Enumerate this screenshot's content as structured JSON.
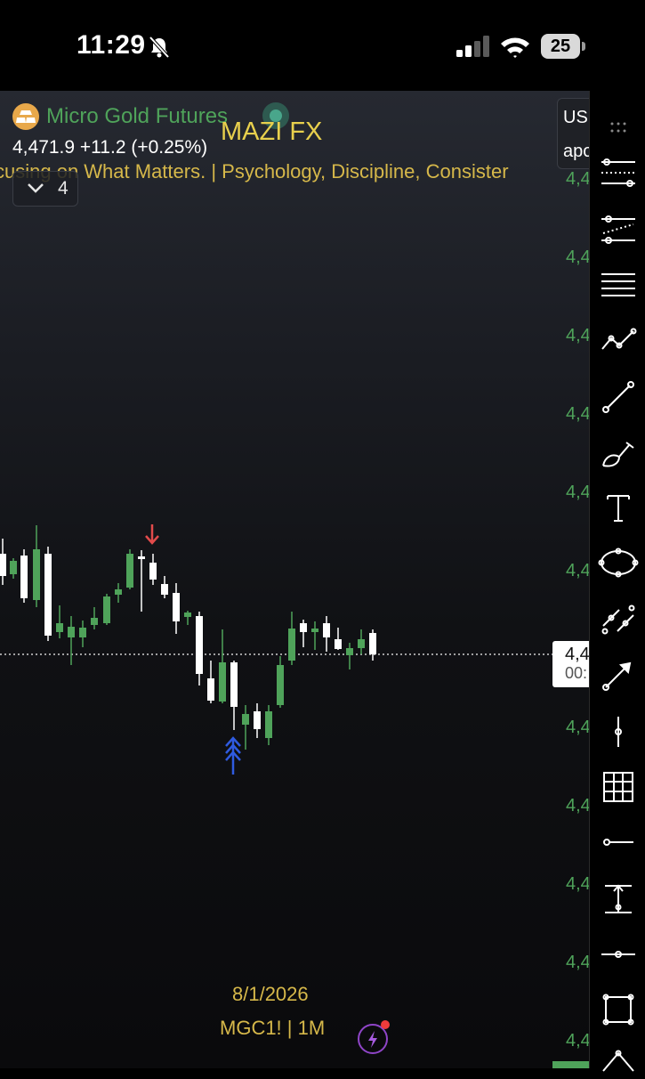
{
  "status_bar": {
    "time": "11:29",
    "battery": "25",
    "icons": [
      "bell-off-icon",
      "cellular-signal-icon",
      "wifi-icon",
      "battery-icon"
    ]
  },
  "chart_header": {
    "symbol_name": "Micro Gold Futures",
    "watermark_title": "MAZI FX",
    "last_price": "4,471.9",
    "change": "+11.2 (+0.25%)",
    "tagline": "cusing on What Matters. | Psychology, Discipline, Consister",
    "indicator_count": "4"
  },
  "currency_box": {
    "line1": "USD",
    "line2": "apo"
  },
  "price_axis": {
    "labels": [
      "4,4",
      "4,4",
      "4,4",
      "4,4",
      "4,4",
      "4,4",
      "4,4",
      "4,4",
      "4,4",
      "4,4",
      "4,4",
      "4,4"
    ],
    "current_price_tag": "4,4",
    "countdown": "00:"
  },
  "footer": {
    "date": "8/1/2026",
    "ticker": "MGC1! | 1M"
  },
  "colors": {
    "up_candle": "#4fa35a",
    "down_candle": "#ffffff",
    "price_text": "#4fa35a",
    "watermark": "#e8d04d",
    "sell_arrow": "#e24b4b",
    "buy_arrow": "#2f5be0"
  },
  "toolbar": {
    "tools": [
      "drag-handle-icon",
      "horizontal-ray-icon",
      "parallel-channel-icon",
      "horizontal-lines-icon",
      "zigzag-pattern-icon",
      "trend-line-icon",
      "brush-icon",
      "text-icon",
      "ellipse-icon",
      "parallel-lines-icon",
      "arrow-icon",
      "vertical-line-icon",
      "grid-icon",
      "horizontal-segment-icon",
      "price-range-icon",
      "cross-line-icon",
      "rectangle-icon",
      "path-icon"
    ]
  }
}
